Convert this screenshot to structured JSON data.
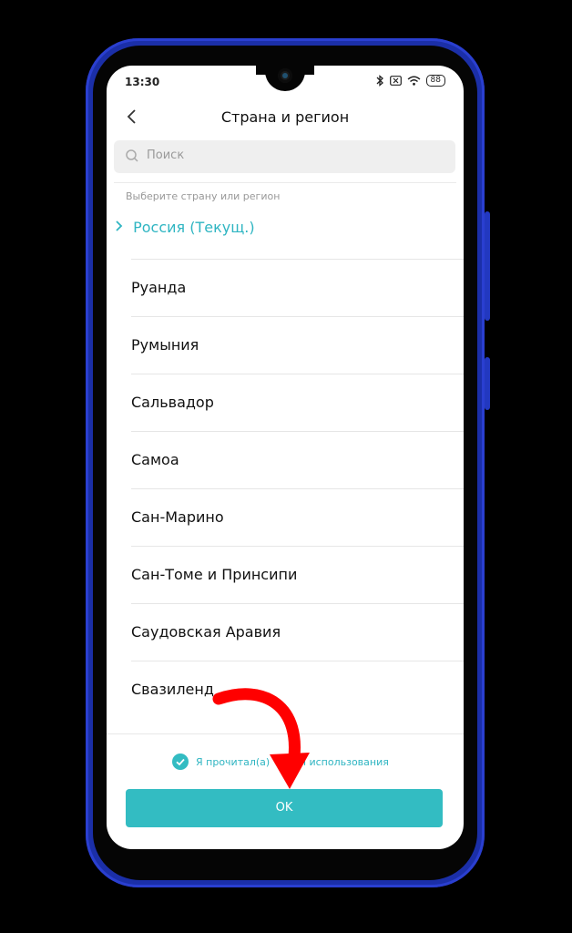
{
  "status_bar": {
    "time": "13:30",
    "battery": "88"
  },
  "header": {
    "title": "Страна и регион"
  },
  "search": {
    "placeholder": "Поиск"
  },
  "hint": "Выберите страну или регион",
  "current_region": "Россия (Текущ.)",
  "countries": [
    "Руанда",
    "Румыния",
    "Сальвадор",
    "Самоа",
    "Сан-Марино",
    "Сан-Томе и Принсипи",
    "Саудовская Аравия",
    "Свазиленд"
  ],
  "agreement": {
    "text": "Я прочитал(а)",
    "text_tail": "ия использования",
    "checked": true
  },
  "ok_button": {
    "label": "OK"
  },
  "colors": {
    "accent": "#33bcc2",
    "frame": "#1b2fa8",
    "annotation_arrow": "#ff0000"
  },
  "icons": [
    "back-arrow-icon",
    "search-icon",
    "bluetooth-icon",
    "sim-icon",
    "wifi-icon",
    "battery-icon",
    "chevron-right-icon",
    "check-circle-icon",
    "red-pointer-arrow"
  ]
}
